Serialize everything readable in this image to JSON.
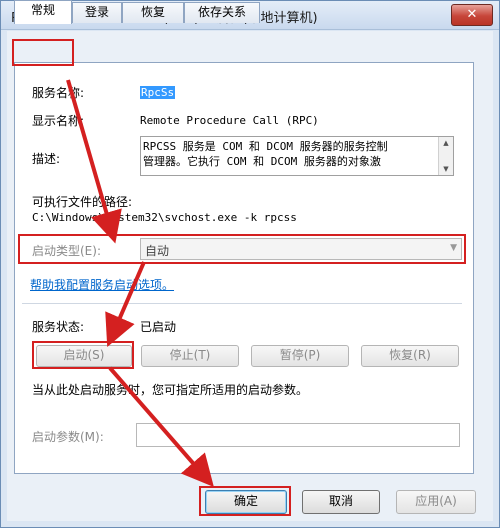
{
  "window": {
    "title": "Remote Procedure Call (RPC) 的属性(本地计算机)",
    "close_glyph": "✕"
  },
  "tabs": [
    {
      "label": "常规",
      "active": true
    },
    {
      "label": "登录",
      "active": false
    },
    {
      "label": "恢复",
      "active": false
    },
    {
      "label": "依存关系",
      "active": false
    }
  ],
  "fields": {
    "service_name_label": "服务名称:",
    "service_name_value": "RpcSs",
    "display_name_label": "显示名称:",
    "display_name_value": "Remote Procedure Call (RPC)",
    "description_label": "描述:",
    "description_value": "RPCSS 服务是 COM 和 DCOM 服务器的服务控制\n管理器。它执行 COM 和 DCOM 服务器的对象激",
    "exe_path_label": "可执行文件的路径:",
    "exe_path_value": "C:\\Windows\\system32\\svchost.exe -k rpcss",
    "startup_type_label": "启动类型(E):",
    "startup_type_value": "自动",
    "help_link": "帮助我配置服务启动选项。"
  },
  "status": {
    "label": "服务状态:",
    "value": "已启动",
    "buttons": [
      {
        "label": "启动(S)",
        "enabled": false
      },
      {
        "label": "停止(T)",
        "enabled": false
      },
      {
        "label": "暂停(P)",
        "enabled": false
      },
      {
        "label": "恢复(R)",
        "enabled": false
      }
    ],
    "hint": "当从此处启动服务时，您可指定所适用的启动参数。",
    "params_label": "启动参数(M):",
    "params_value": ""
  },
  "footer": {
    "ok_label": "确定",
    "cancel_label": "取消",
    "apply_label": "应用(A)"
  },
  "colors": {
    "annotation": "#d42020",
    "link": "#0066cc",
    "selection": "#3399ff"
  }
}
